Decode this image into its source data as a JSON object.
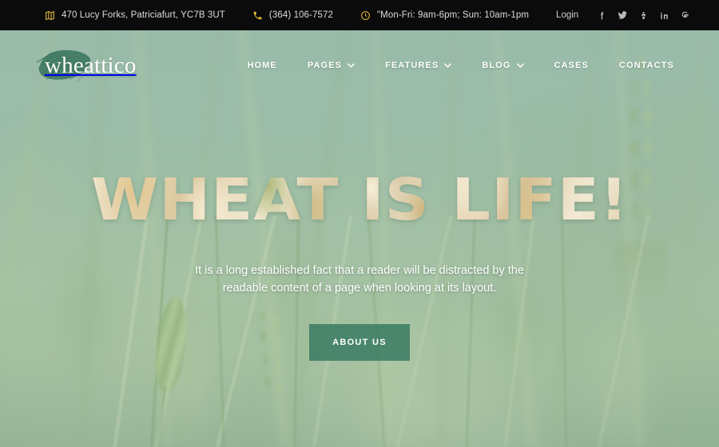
{
  "topbar": {
    "address": "470 Lucy Forks, Patriciafurt, YC7B 3UT",
    "address_icon": "map-icon",
    "phone": "(364) 106-7572",
    "phone_icon": "phone-icon",
    "hours": "\"Mon-Fri: 9am-6pm; Sun: 10am-1pm",
    "hours_icon": "clock-icon",
    "login_label": "Login",
    "socials": [
      {
        "name": "facebook-icon",
        "glyph": "f"
      },
      {
        "name": "twitter-icon",
        "glyph": "t"
      },
      {
        "name": "youtube-icon",
        "glyph": "y"
      },
      {
        "name": "linkedin-icon",
        "glyph": "in"
      },
      {
        "name": "google-icon",
        "glyph": "G"
      }
    ],
    "background_color": "#0b0b0b",
    "icon_color": "#e3b93c",
    "text_color": "#dcdcdc"
  },
  "header": {
    "logo": "wheattico",
    "logo_brush_color": "#2f6d55",
    "nav": [
      {
        "label": "HOME",
        "has_dropdown": false
      },
      {
        "label": "PAGES",
        "has_dropdown": true
      },
      {
        "label": "FEATURES",
        "has_dropdown": true
      },
      {
        "label": "BLOG",
        "has_dropdown": true
      },
      {
        "label": "CASES",
        "has_dropdown": false
      },
      {
        "label": "CONTACTS",
        "has_dropdown": false
      }
    ]
  },
  "hero": {
    "title": "WHEAT IS LIFE!",
    "subtitle": "It is a long established fact that a reader will be distracted by the readable content of a page when looking at its layout.",
    "button_label": "ABOUT US",
    "button_color": "#2f745c",
    "background_tint": "#9cbda8"
  }
}
